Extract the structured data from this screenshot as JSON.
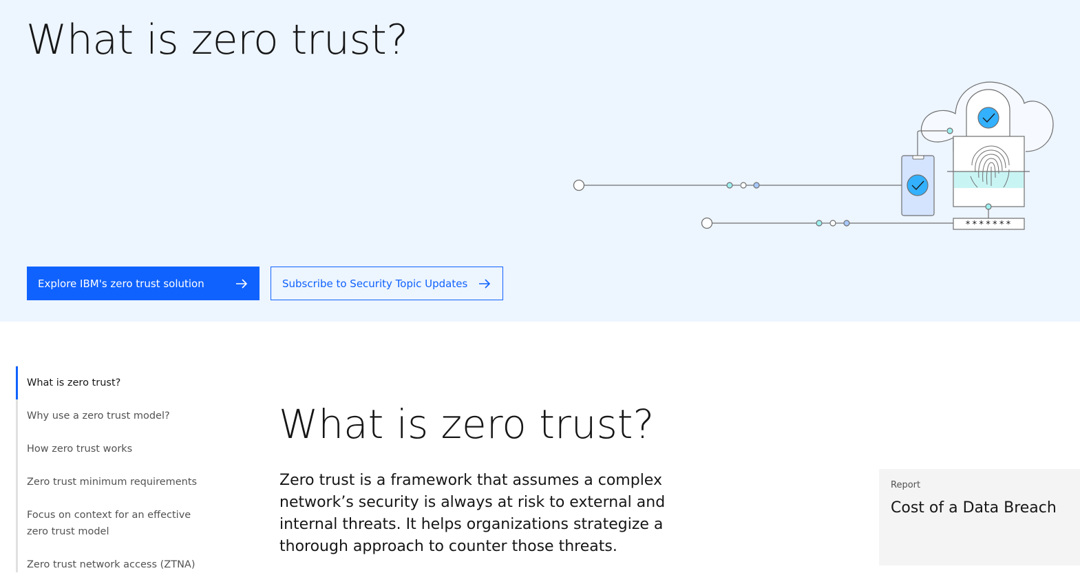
{
  "hero": {
    "title": "What is zero trust?",
    "primary_button": "Explore IBM's zero trust solution",
    "secondary_button": "Subscribe to Security Topic Updates",
    "password_mask": "*******"
  },
  "toc": {
    "items": [
      {
        "label": "What is zero trust?",
        "active": true
      },
      {
        "label": "Why use a zero trust model?"
      },
      {
        "label": "How zero trust works"
      },
      {
        "label": "Zero trust minimum requirements"
      },
      {
        "label": "Focus on context for an effective zero trust model"
      },
      {
        "label": "Zero trust network access (ZTNA)"
      }
    ]
  },
  "main": {
    "title": "What is zero trust?",
    "paragraph": "Zero trust is a framework that assumes a complex network’s security is always at risk to external and internal threats. It helps organizations strategize a thorough approach to counter those threats."
  },
  "report": {
    "eyebrow": "Report",
    "title": "Cost of a Data Breach"
  },
  "colors": {
    "hero_bg": "#edf5ff",
    "accent": "#0f62fe",
    "text": "#161616",
    "muted": "#525252",
    "card_bg": "#f4f4f4"
  },
  "icons": [
    "arrow-right-icon",
    "cloud-icon",
    "checkmark-icon",
    "fingerprint-icon",
    "mobile-phone-icon"
  ]
}
